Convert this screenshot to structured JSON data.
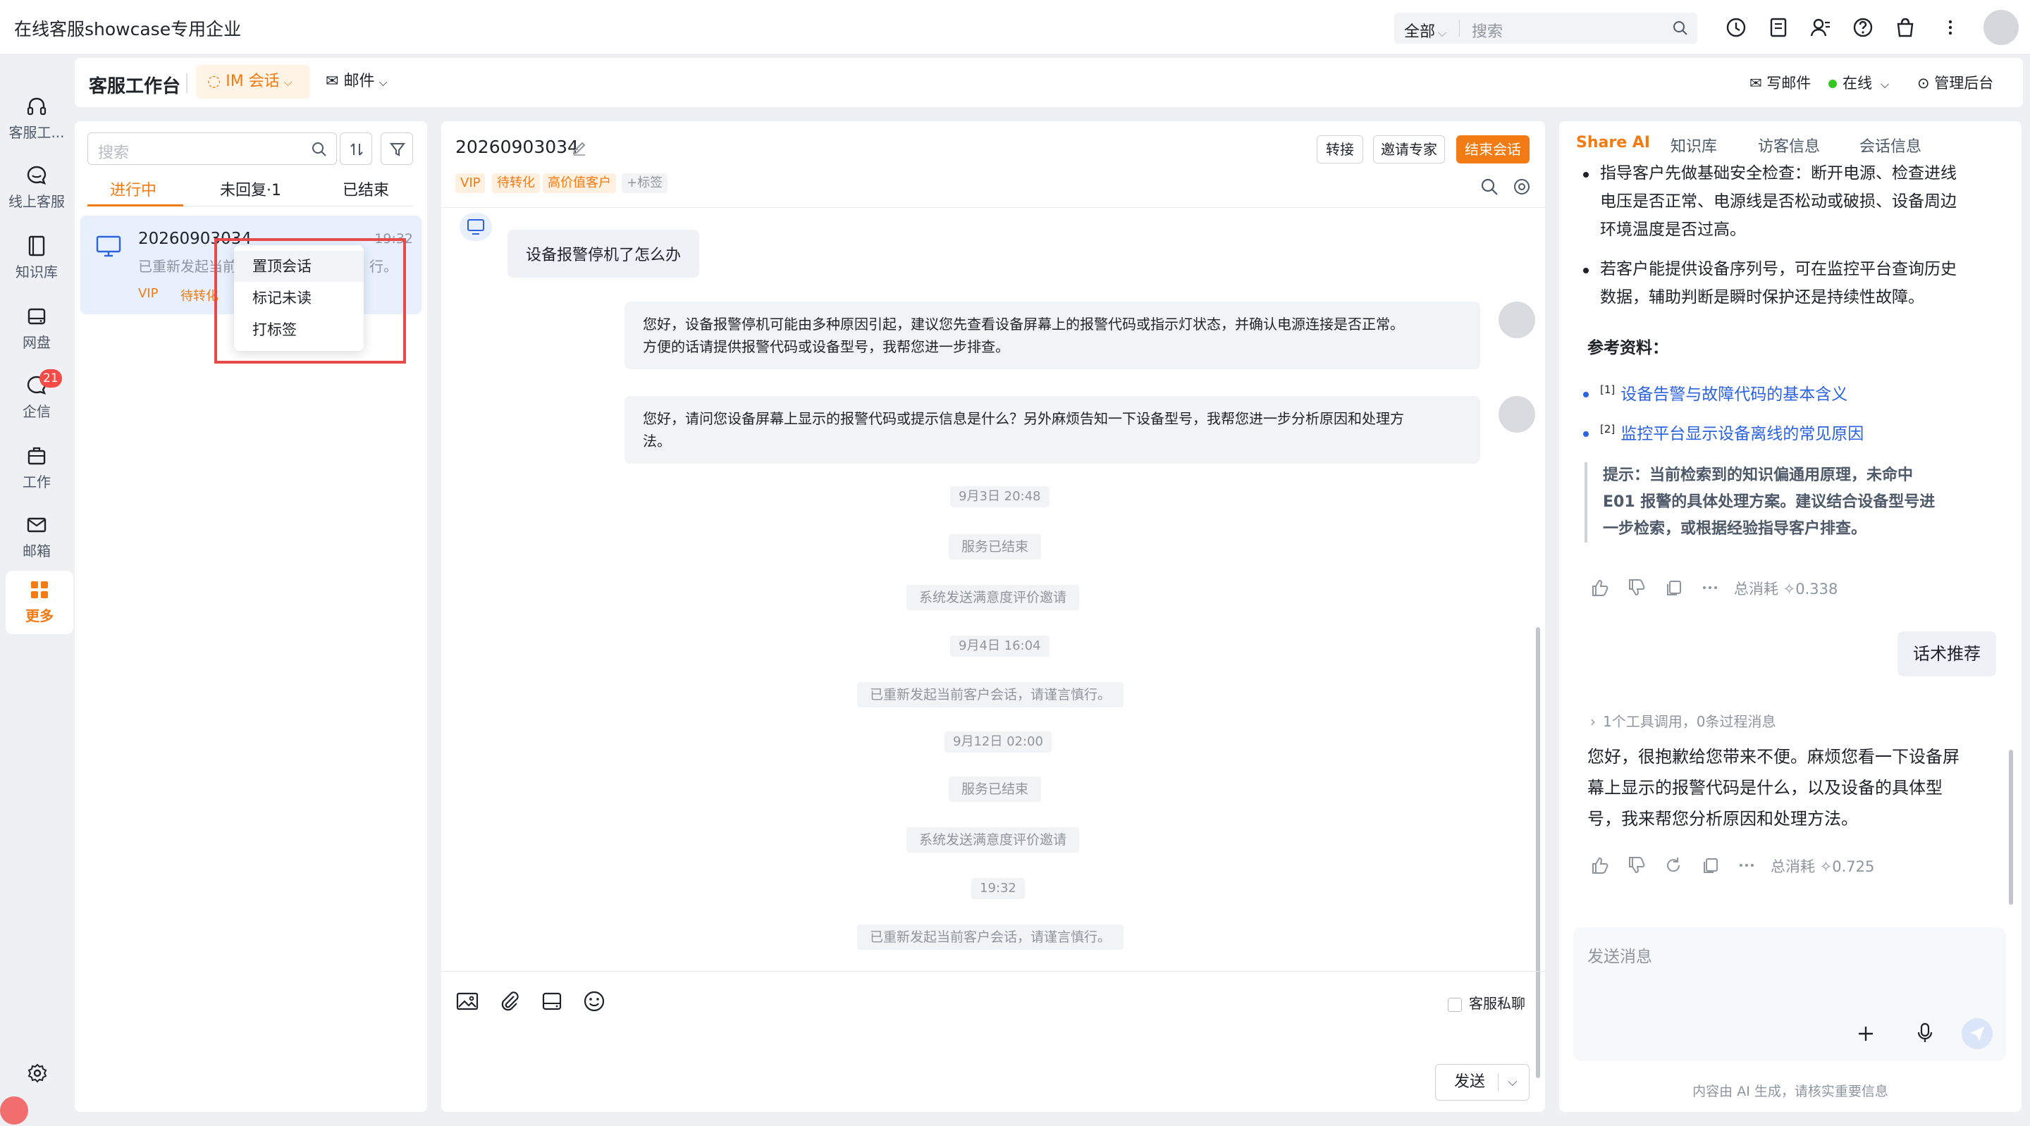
{
  "app": {
    "title": "在线客服showcase专用企业"
  },
  "top_search": {
    "scope": "全部",
    "placeholder": "搜索"
  },
  "left_nav": {
    "items": [
      {
        "label": "客服工..."
      },
      {
        "label": "线上客服"
      },
      {
        "label": "知识库"
      },
      {
        "label": "网盘"
      },
      {
        "label": "企信",
        "badge": "21"
      },
      {
        "label": "工作"
      },
      {
        "label": "邮箱"
      },
      {
        "label": "更多"
      }
    ]
  },
  "workbench": {
    "title": "客服工作台",
    "im_tab": "IM 会话",
    "mail_tab": "邮件",
    "write_mail": "写邮件",
    "status": "在线",
    "admin": "管理后台"
  },
  "conv_list": {
    "search_placeholder": "搜索",
    "tabs": [
      "进行中",
      "未回复·1",
      "已结束"
    ],
    "item": {
      "name": "20260903034",
      "time": "19:32",
      "preview_a": "已重新发起当前",
      "preview_b": "行。",
      "tags": [
        "VIP",
        "待转化"
      ]
    },
    "context_menu": [
      "置顶会话",
      "标记未读",
      "打标签"
    ]
  },
  "chat": {
    "title": "20260903034",
    "tags": [
      "VIP",
      "待转化",
      "高价值客户",
      "+标签"
    ],
    "buttons": {
      "transfer": "转接",
      "invite": "邀请专家",
      "end": "结束会话"
    },
    "customer_msg": "设备报警停机了怎么办",
    "agent_msgs": [
      {
        "line1": "您好，设备报警停机可能由多种原因引起，建议您先查看设备屏幕上的报警代码或指示灯状态，并确认电源连接是否正常。",
        "line2": "方便的话请提供报警代码或设备型号，我帮您进一步排查。"
      },
      {
        "line1": "您好，请问您设备屏幕上显示的报警代码或提示信息是什么？另外麻烦告知一下设备型号，我帮您进一步分析原因和处理方",
        "line2": "法。"
      }
    ],
    "system": [
      "9月3日 20:48",
      "服务已结束",
      "系统发送满意度评价邀请",
      "9月4日 16:04",
      "已重新发起当前客户会话，请谨言慎行。",
      "9月12日 02:00",
      "服务已结束",
      "系统发送满意度评价邀请",
      "19:32",
      "已重新发起当前客户会话，请谨言慎行。"
    ],
    "private_chat": "客服私聊",
    "send": "发送"
  },
  "ai": {
    "tabs": [
      "Share AI",
      "知识库",
      "访客信息",
      "会话信息"
    ],
    "bullet1": [
      "指导客户先做基础安全检查：断开电源、检查进线",
      "电压是否正常、电源线是否松动或破损、设备周边",
      "环境温度是否过高。"
    ],
    "bullet2": [
      "若客户能提供设备序列号，可在监控平台查询历史",
      "数据，辅助判断是瞬时保护还是持续性故障。"
    ],
    "refs_title": "参考资料：",
    "refs": [
      {
        "num": "[1]",
        "text": "设备告警与故障代码的基本含义"
      },
      {
        "num": "[2]",
        "text": "监控平台显示设备离线的常见原因"
      }
    ],
    "note": [
      "提示：当前检索到的知识偏通用原理，未命中",
      "E01 报警的具体处理方案。建议结合设备型号进",
      "一步检索，或根据经验指导客户排查。"
    ],
    "cost1": "总消耗 ✧0.338",
    "user_msg": "话术推荐",
    "tool_call": "1个工具调用，0条过程消息",
    "reply": [
      "您好，很抱歉给您带来不便。麻烦您看一下设备屏",
      "幕上显示的报警代码是什么，以及设备的具体型",
      "号，我来帮您分析原因和处理方法。"
    ],
    "cost2": "总消耗 ✧0.725",
    "input_placeholder": "发送消息",
    "footer": "内容由 AI 生成，请核实重要信息"
  },
  "colors": {
    "accent": "#f27b14",
    "link": "#2b62e0",
    "online": "#34c724",
    "badge": "#f54a45"
  }
}
